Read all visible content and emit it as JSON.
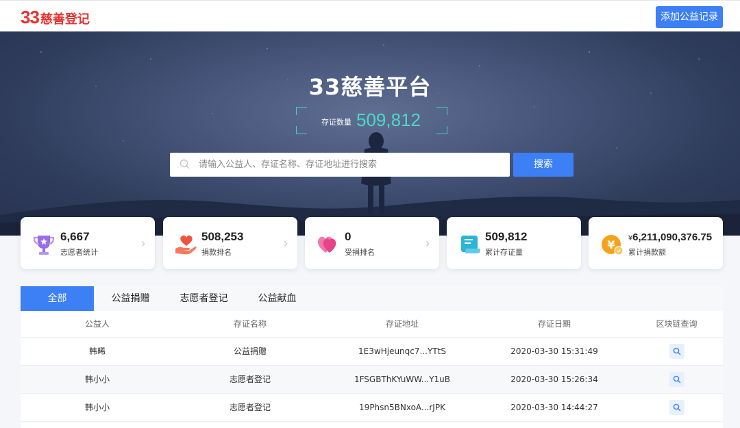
{
  "header": {
    "logo_num": "33",
    "logo_text": "慈善登记",
    "add_button": "添加公益记录"
  },
  "hero": {
    "title": "33慈善平台",
    "counter_label": "存证数量",
    "counter_value": "509,812",
    "search_placeholder": "请输入公益人、存证名称、存证地址进行搜索",
    "search_button": "搜索"
  },
  "stats": [
    {
      "icon": "trophy-icon",
      "value": "6,667",
      "label": "志愿者统计",
      "color": "#9b6be8"
    },
    {
      "icon": "hand-heart-icon",
      "value": "508,253",
      "label": "捐款排名",
      "color": "#f0533f"
    },
    {
      "icon": "heart-icon",
      "value": "0",
      "label": "受捐排名",
      "color": "#e8448c"
    },
    {
      "icon": "certificate-icon",
      "value": "509,812",
      "label": "累计存证量",
      "color": "#2fb4d6"
    },
    {
      "icon": "yuan-coin-icon",
      "value_prefix": "¥",
      "value": "6,211,090,376.75",
      "label": "累计捐款额",
      "color": "#f6a21c"
    }
  ],
  "tabs": [
    "全部",
    "公益捐赠",
    "志愿者登记",
    "公益献血"
  ],
  "table": {
    "headers": [
      "公益人",
      "存证名称",
      "存证地址",
      "存证日期",
      "区块链查询"
    ],
    "rows": [
      {
        "person": "韩晞",
        "name": "公益捐赠",
        "address": "1E3wHjeunqc7...YTtS",
        "date": "2020-03-30 15:31:49"
      },
      {
        "person": "韩小小",
        "name": "志愿者登记",
        "address": "1FSGBThKYuWW...Y1uB",
        "date": "2020-03-30 15:26:34"
      },
      {
        "person": "韩小小",
        "name": "志愿者登记",
        "address": "19Phsn5BNxoA...rJPK",
        "date": "2020-03-30 14:44:27"
      }
    ]
  },
  "colors": {
    "accent": "#3d7ff5",
    "brand_red": "#e8312f",
    "counter_teal": "#4fd6c8"
  }
}
